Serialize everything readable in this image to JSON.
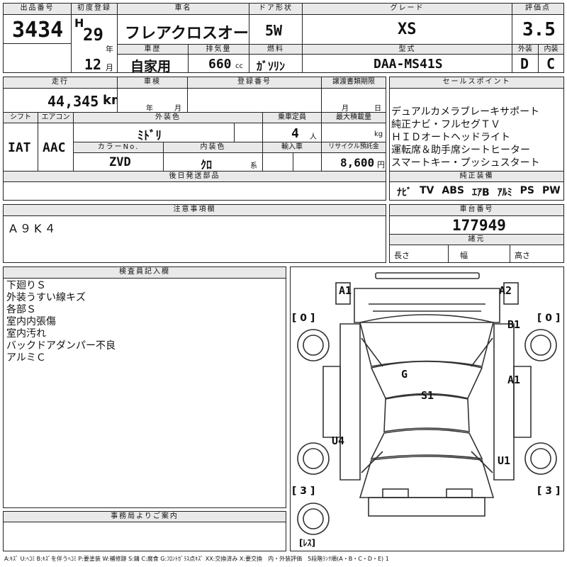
{
  "header": {
    "lot_no_label": "出品番号",
    "lot_no": "3434",
    "first_reg_label": "初度登録",
    "era": "H",
    "year": "29",
    "year_unit": "年",
    "month": "12",
    "month_unit": "月",
    "car_name_label": "車名",
    "car_name": "フレアクロスオーバー",
    "door_label": "ドア形状",
    "door": "5W",
    "grade_label": "グレード",
    "grade": "XS",
    "score_label": "評価点",
    "score": "3.5",
    "exterior_label": "外装",
    "exterior": "D",
    "interior_label": "内装",
    "interior": "C",
    "history_label": "車歴",
    "history": "自家用",
    "displacement_label": "排気量",
    "displacement": "660",
    "displacement_unit": "cc",
    "fuel_label": "燃料",
    "fuel": "ｶﾞｿﾘﾝ",
    "model_label": "型式",
    "model": "DAA-MS41S"
  },
  "specs": {
    "mileage_label": "走行",
    "mileage": "44,345",
    "mileage_unit": "km",
    "inspection_label": "車検",
    "inspection_year_unit": "年",
    "inspection_month_unit": "月",
    "reg_no_label": "登録番号",
    "transfer_label": "譲渡書類期限",
    "transfer_month_unit": "月",
    "transfer_day_unit": "日",
    "shift_label": "シフト",
    "shift": "IAT",
    "ac_label": "エアコン",
    "ac": "AAC",
    "ext_color_label": "外装色",
    "ext_color": "ﾐﾄﾞﾘ",
    "capacity_label": "乗車定員",
    "capacity": "4",
    "capacity_unit": "人",
    "load_label": "最大積載量",
    "load_unit": "kg",
    "color_no_label": "カラーNo.",
    "color_no": "ZVD",
    "int_color_label": "内装色",
    "int_color": "ｸﾛ",
    "int_color_unit": "系",
    "import_label": "輸入車",
    "recycle_label": "リサイクル預託金",
    "recycle": "8,600",
    "recycle_unit": "円",
    "later_parts_label": "後日発送部品"
  },
  "sales": {
    "label": "セールスポイント",
    "points": [
      "デュアルカメラブレーキサポート",
      "純正ナビ・フルセグＴＶ",
      "ＨＩＤオートヘッドライト",
      "運転席＆助手席シートヒーター",
      "スマートキー・プッシュスタート"
    ],
    "equip_label": "純正装備",
    "equipment": [
      "ﾅﾋﾞ",
      "TV",
      "ABS",
      "ｴｱB",
      "ｱﾙﾐ",
      "PS",
      "PW"
    ]
  },
  "caution": {
    "label": "注意事項欄",
    "text": "A９K４"
  },
  "chassis": {
    "label": "車台番号",
    "number": "177949"
  },
  "dims": {
    "label": "諸元",
    "length_label": "長さ",
    "width_label": "幅",
    "height_label": "高さ"
  },
  "inspector": {
    "label": "検査員記入欄",
    "lines": [
      "下廻りＳ",
      "外装うすい線キズ",
      "各部Ｓ",
      "室内内張傷",
      "室内汚れ",
      "バックドアダンパー不良",
      "アルミＣ"
    ]
  },
  "office": {
    "label": "事務局よりご案内"
  },
  "diagram": {
    "marks": {
      "a1_tl": "A1",
      "a2_tr": "A2",
      "b1": "B1",
      "a1_r": "A1",
      "g": "G",
      "s1": "S1",
      "u4": "U4",
      "u1": "U1"
    },
    "tire_fl": "[ 0 ]",
    "tire_fr": "[ 0 ]",
    "tire_rl": "[ 3 ]",
    "tire_rr": "[ 3 ]",
    "spare": "[ﾚｽ]"
  },
  "legend": "A:ｷｽﾞ U:ﾍｺﾐ B:ｷｽﾞを伴うﾍｺﾐ P:要塗装 W:補修跡 S:錆 C:腐食 G:ﾌﾛﾝﾄｶﾞﾗｽ点ｷｽﾞ XX:交換済み X:要交換　内・外装評価　5段階ﾗﾝｸ順(A・B・C・D・E) 1"
}
